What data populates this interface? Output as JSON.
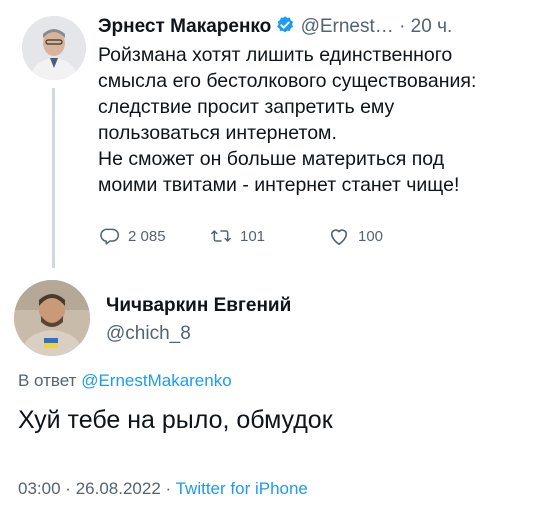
{
  "parent_tweet": {
    "author_name": "Эрнест Макаренко",
    "handle": "@Ernest…",
    "separator": "·",
    "time": "20 ч.",
    "text_lines": [
      "Ройзмана хотят лишить единственного",
      "смысла его бестолкового существования:",
      "следствие просит запретить ему",
      "пользоваться интернетом.",
      "Не сможет он больше материться под",
      "моими твитами - интернет станет чище!"
    ],
    "reply_count": "2 085",
    "retweet_count": "101",
    "like_count": "100",
    "verified": true
  },
  "reply_tweet": {
    "author_name": "Чичваркин Евгений",
    "handle": "@chich_8",
    "reply_to_label": "В ответ",
    "reply_to_mention": "@ErnestMakarenko",
    "text": "Хуй тебе на рыло, обмудок",
    "time": "03:00",
    "separator1": "·",
    "date": "26.08.2022",
    "separator2": "·",
    "source": "Twitter for iPhone"
  },
  "colors": {
    "text_primary": "#0f1419",
    "text_secondary": "#536471",
    "accent": "#1d9bf0",
    "thread_line": "#cfd9de"
  },
  "icons": {
    "reply": "reply-icon",
    "retweet": "retweet-icon",
    "like": "heart-icon",
    "verified": "verified-badge-icon"
  }
}
